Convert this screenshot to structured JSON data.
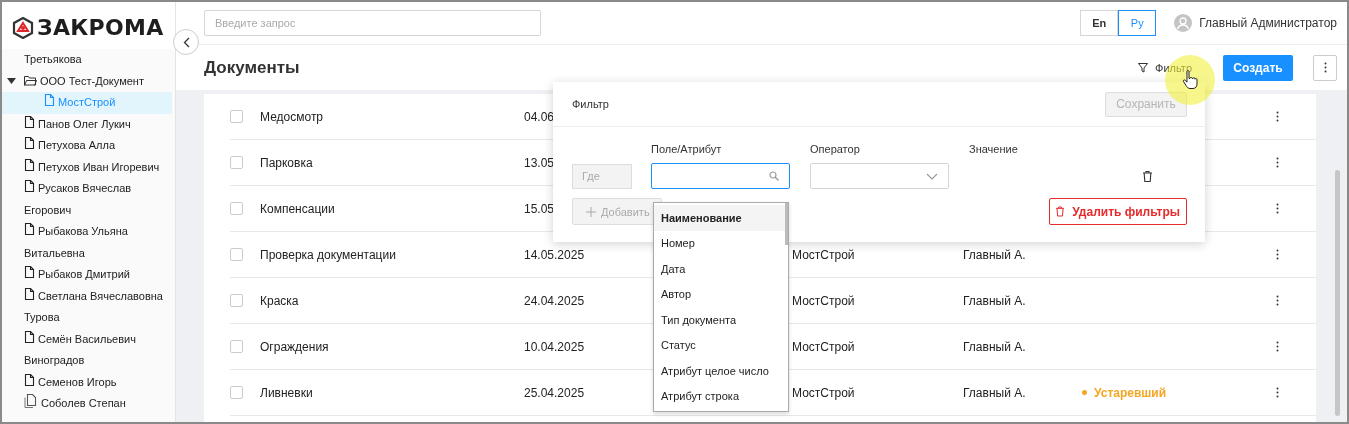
{
  "logo": {
    "text": "ЗАКРОМА"
  },
  "sidebar": {
    "items": [
      {
        "kind": "fragment",
        "label": "Третьякова",
        "selected": false
      },
      {
        "kind": "folder",
        "label": "ООО Тест-Документ",
        "expanded": true,
        "selected": false,
        "children": [
          {
            "kind": "document",
            "label": "МостСтрой",
            "selected": true
          }
        ]
      },
      {
        "kind": "document",
        "label": "Панов Олег Лукич",
        "selected": false
      },
      {
        "kind": "document",
        "label": "Петухова Алла",
        "selected": false
      },
      {
        "kind": "document",
        "label": "Петухов Иван Игоревич",
        "selected": false
      },
      {
        "kind": "document",
        "label": "Русаков Вячеслав Егорович",
        "selected": false
      },
      {
        "kind": "document",
        "label": "Рыбакова Ульяна Витальевна",
        "selected": false
      },
      {
        "kind": "document",
        "label": "Рыбаков Дмитрий",
        "selected": false
      },
      {
        "kind": "document",
        "label": "Светлана Вячеславовна Турова",
        "selected": false
      },
      {
        "kind": "document",
        "label": "Семён Васильевич Виноградов",
        "selected": false
      },
      {
        "kind": "document",
        "label": "Семенов Игорь",
        "selected": false
      },
      {
        "kind": "documents",
        "label": "Соболев Степан",
        "selected": false
      }
    ]
  },
  "search": {
    "placeholder": "Введите запрос"
  },
  "languages": [
    {
      "label": "En",
      "selected": false
    },
    {
      "label": "Ру",
      "selected": true
    }
  ],
  "user": {
    "name": "Главный Администратор"
  },
  "page_title": "Документы",
  "toolbar": {
    "filter_label": "Фильтр",
    "create_label": "Создать"
  },
  "table": {
    "rows": [
      {
        "checked": false,
        "name": "Медосмотр",
        "date": "04.06"
      },
      {
        "checked": false,
        "name": "Парковка",
        "date": "13.05"
      },
      {
        "checked": false,
        "name": "Компенсации",
        "date": "15.05"
      },
      {
        "checked": false,
        "name": "Проверка документации",
        "date": "14.05.2025",
        "column_3": "МостСтрой",
        "column_4": "Главный А."
      },
      {
        "checked": false,
        "name": "Краска",
        "date": "24.04.2025",
        "column_3": "МостСтрой",
        "column_4": "Главный А."
      },
      {
        "checked": false,
        "name": "Ограждения",
        "date": "10.04.2025",
        "column_3": "МостСтрой",
        "column_4": "Главный А."
      },
      {
        "checked": false,
        "name": "Ливневки",
        "date": "25.04.2025",
        "column_3": "МостСтрой",
        "column_4": "Главный А.",
        "status": {
          "label": "Устаревший",
          "color": "#f5a623"
        }
      }
    ]
  },
  "filter_panel": {
    "title": "Фильтр",
    "save_label": "Сохранить",
    "save_disabled": true,
    "columns": [
      "Поле/Атрибут",
      "Оператор",
      "Значение"
    ],
    "where_label": "Где",
    "add_label": "Добавить",
    "add_disabled": true,
    "delete_label": "Удалить фильтры"
  },
  "attribute_dropdown": {
    "items": [
      {
        "label": "Наименование",
        "selected": true
      },
      {
        "label": "Номер",
        "selected": false
      },
      {
        "label": "Дата",
        "selected": false
      },
      {
        "label": "Автор",
        "selected": false
      },
      {
        "label": "Тип документа",
        "selected": false
      },
      {
        "label": "Статус",
        "selected": false
      },
      {
        "label": "Атрибут целое число",
        "selected": false
      },
      {
        "label": "Атрибут строка",
        "selected": false
      }
    ]
  }
}
